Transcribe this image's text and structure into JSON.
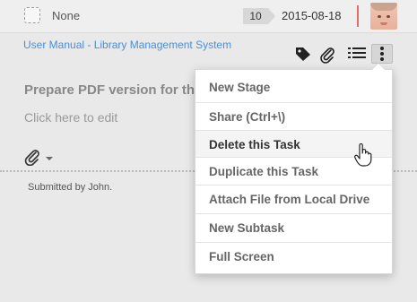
{
  "task": {
    "assignee": "None",
    "count": "10",
    "date": "2015-08-18"
  },
  "breadcrumb": "User Manual - Library Management System",
  "title": "Prepare PDF version for the",
  "edit_hint": "Click here to edit",
  "submitted": "Submitted by John.",
  "toolbar": {
    "icons": [
      "tag-icon",
      "paperclip-icon",
      "list-icon",
      "more-vertical-icon"
    ]
  },
  "menu": {
    "items": [
      {
        "label": "New Stage"
      },
      {
        "label": "Share (Ctrl+\\)"
      },
      {
        "label": "Delete this Task"
      },
      {
        "label": "Duplicate this Task"
      },
      {
        "label": "Attach File from Local Drive"
      },
      {
        "label": "New Subtask"
      },
      {
        "label": "Full Screen"
      }
    ]
  },
  "colors": {
    "link": "#4a8fd8",
    "accent_separator": "#e26b6b"
  }
}
